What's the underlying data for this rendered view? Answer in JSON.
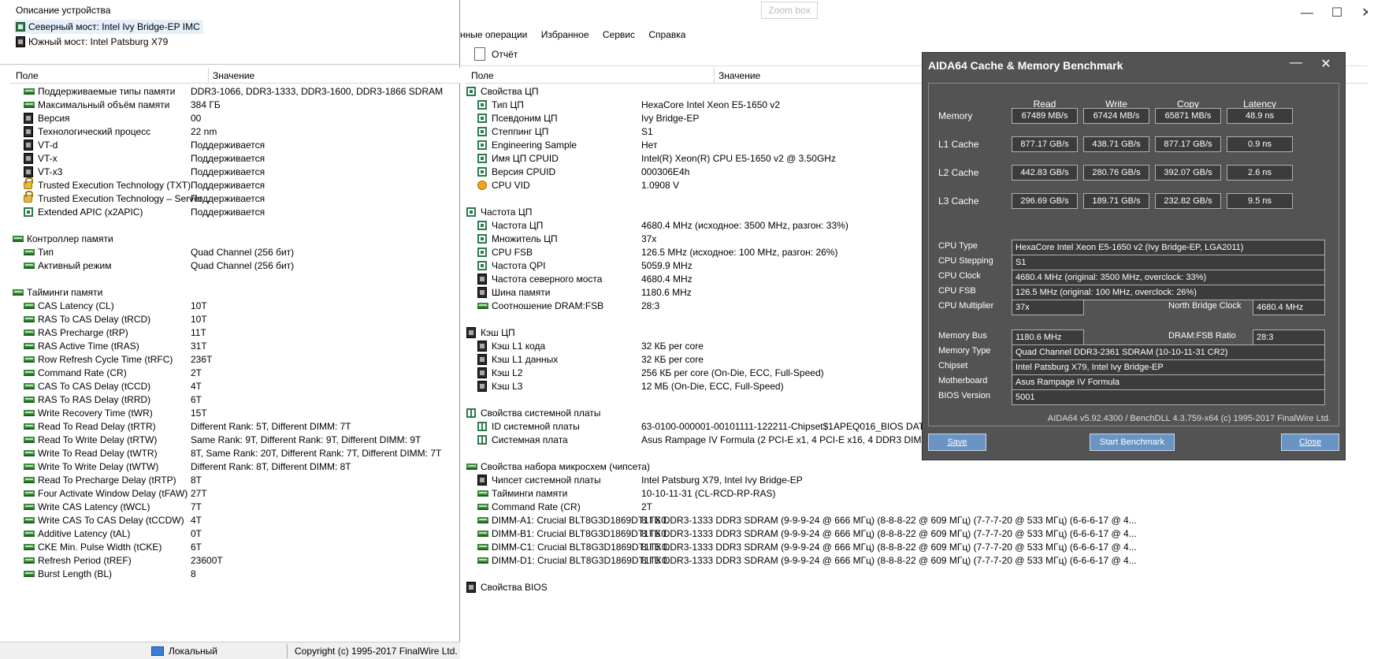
{
  "left": {
    "device_desc_title": "Описание устройства",
    "devices": [
      "Северный мост: Intel Ivy Bridge-EP IMC",
      "Южный мост: Intel Patsburg X79"
    ],
    "col_field": "Поле",
    "col_value": "Значение",
    "rows": [
      {
        "f": "Поддерживаемые типы памяти",
        "v": "DDR3-1066, DDR3-1333, DDR3-1600, DDR3-1866 SDRAM",
        "icon": "mem"
      },
      {
        "f": "Максимальный объём памяти",
        "v": "384 ГБ",
        "icon": "mem"
      },
      {
        "f": "Версия",
        "v": "00",
        "icon": "chip-black"
      },
      {
        "f": "Технологический процесс",
        "v": "22 nm",
        "icon": "chip-black"
      },
      {
        "f": "VT-d",
        "v": "Поддерживается",
        "icon": "vt"
      },
      {
        "f": "VT-x",
        "v": "Поддерживается",
        "icon": "vt"
      },
      {
        "f": "VT-x3",
        "v": "Поддерживается",
        "icon": "vt"
      },
      {
        "f": "Trusted Execution Technology (TXT)",
        "v": "Поддерживается",
        "icon": "lock"
      },
      {
        "f": "Trusted Execution Technology – Server...",
        "v": "Поддерживается",
        "icon": "lock"
      },
      {
        "f": "Extended APIC (x2APIC)",
        "v": "Поддерживается",
        "icon": "cpu"
      },
      {
        "f": "",
        "v": "",
        "icon": ""
      },
      {
        "f": "Контроллер памяти",
        "v": "",
        "icon": "mem",
        "group": true
      },
      {
        "f": "Тип",
        "v": "Quad Channel  (256 бит)",
        "icon": "mem"
      },
      {
        "f": "Активный режим",
        "v": "Quad Channel  (256 бит)",
        "icon": "mem"
      },
      {
        "f": "",
        "v": "",
        "icon": ""
      },
      {
        "f": "Тайминги памяти",
        "v": "",
        "icon": "mem",
        "group": true
      },
      {
        "f": "CAS Latency (CL)",
        "v": "10T",
        "icon": "mem"
      },
      {
        "f": "RAS To CAS Delay (tRCD)",
        "v": "10T",
        "icon": "mem"
      },
      {
        "f": "RAS Precharge (tRP)",
        "v": "11T",
        "icon": "mem"
      },
      {
        "f": "RAS Active Time (tRAS)",
        "v": "31T",
        "icon": "mem"
      },
      {
        "f": "Row Refresh Cycle Time (tRFC)",
        "v": "236T",
        "icon": "mem"
      },
      {
        "f": "Command Rate (CR)",
        "v": "2T",
        "icon": "mem"
      },
      {
        "f": "CAS To CAS Delay (tCCD)",
        "v": "4T",
        "icon": "mem"
      },
      {
        "f": "RAS To RAS Delay (tRRD)",
        "v": "6T",
        "icon": "mem"
      },
      {
        "f": "Write Recovery Time (tWR)",
        "v": "15T",
        "icon": "mem"
      },
      {
        "f": "Read To Read Delay (tRTR)",
        "v": "Different Rank: 5T, Different DIMM: 7T",
        "icon": "mem"
      },
      {
        "f": "Read To Write Delay (tRTW)",
        "v": "Same Rank: 9T, Different Rank: 9T, Different DIMM: 9T",
        "icon": "mem"
      },
      {
        "f": "Write To Read Delay (tWTR)",
        "v": "8T, Same Rank: 20T, Different Rank: 7T, Different DIMM: 7T",
        "icon": "mem"
      },
      {
        "f": "Write To Write Delay (tWTW)",
        "v": "Different Rank: 8T, Different DIMM: 8T",
        "icon": "mem"
      },
      {
        "f": "Read To Precharge Delay (tRTP)",
        "v": "8T",
        "icon": "mem"
      },
      {
        "f": "Four Activate Window Delay (tFAW)",
        "v": "27T",
        "icon": "mem"
      },
      {
        "f": "Write CAS Latency (tWCL)",
        "v": "7T",
        "icon": "mem"
      },
      {
        "f": "Write CAS To CAS Delay (tCCDW)",
        "v": "4T",
        "icon": "mem"
      },
      {
        "f": "Additive Latency (tAL)",
        "v": "0T",
        "icon": "mem"
      },
      {
        "f": "CKE Min. Pulse Width (tCKE)",
        "v": "6T",
        "icon": "mem"
      },
      {
        "f": "Refresh Period (tREF)",
        "v": "23600T",
        "icon": "mem"
      },
      {
        "f": "Burst Length (BL)",
        "v": "8",
        "icon": "mem"
      }
    ],
    "status_local": "Локальный",
    "status_copyright": "Copyright (c) 1995-2017 FinalWire Ltd."
  },
  "right": {
    "menu": [
      "нные операции",
      "Избранное",
      "Сервис",
      "Справка"
    ],
    "zoom_box": "Zoom box",
    "report_label": "Отчёт",
    "col_field": "Поле",
    "col_value": "Значение",
    "rows": [
      {
        "f": "Свойства ЦП",
        "v": "",
        "icon": "cpu",
        "group": true
      },
      {
        "f": "Тип ЦП",
        "v": "HexaCore Intel Xeon E5-1650 v2",
        "icon": "cpu"
      },
      {
        "f": "Псевдоним ЦП",
        "v": "Ivy Bridge-EP",
        "icon": "cpu"
      },
      {
        "f": "Степпинг ЦП",
        "v": "S1",
        "icon": "cpu"
      },
      {
        "f": "Engineering Sample",
        "v": "Нет",
        "icon": "cpu"
      },
      {
        "f": "Имя ЦП CPUID",
        "v": "Intel(R) Xeon(R) CPU E5-1650 v2 @ 3.50GHz",
        "icon": "cpu"
      },
      {
        "f": "Версия CPUID",
        "v": "000306E4h",
        "icon": "cpu"
      },
      {
        "f": "CPU VID",
        "v": "1.0908 V",
        "icon": "vid"
      },
      {
        "f": "",
        "v": "",
        "icon": ""
      },
      {
        "f": "Частота ЦП",
        "v": "",
        "icon": "cpu",
        "group": true
      },
      {
        "f": "Частота ЦП",
        "v": "4680.4 MHz  (исходное: 3500 MHz, разгон: 33%)",
        "icon": "cpu"
      },
      {
        "f": "Множитель ЦП",
        "v": "37x",
        "icon": "cpu"
      },
      {
        "f": "CPU FSB",
        "v": "126.5 MHz  (исходное: 100 MHz, разгон: 26%)",
        "icon": "cpu"
      },
      {
        "f": "Частота QPI",
        "v": "5059.9 MHz",
        "icon": "cpu"
      },
      {
        "f": "Частота северного моста",
        "v": "4680.4 MHz",
        "icon": "chip-black"
      },
      {
        "f": "Шина памяти",
        "v": "1180.6 MHz",
        "icon": "chip-black"
      },
      {
        "f": "Соотношение DRAM:FSB",
        "v": "28:3",
        "icon": "mem"
      },
      {
        "f": "",
        "v": "",
        "icon": ""
      },
      {
        "f": "Кэш ЦП",
        "v": "",
        "icon": "chip-black",
        "group": true
      },
      {
        "f": "Кэш L1 кода",
        "v": "32 КБ per core",
        "icon": "chip-black"
      },
      {
        "f": "Кэш L1 данных",
        "v": "32 КБ per core",
        "icon": "chip-black"
      },
      {
        "f": "Кэш L2",
        "v": "256 КБ per core  (On-Die, ECC, Full-Speed)",
        "icon": "chip-black"
      },
      {
        "f": "Кэш L3",
        "v": "12 МБ  (On-Die, ECC, Full-Speed)",
        "icon": "chip-black"
      },
      {
        "f": "",
        "v": "",
        "icon": ""
      },
      {
        "f": "Свойства системной платы",
        "v": "",
        "icon": "board",
        "group": true
      },
      {
        "f": "ID системной платы",
        "v": "63-0100-000001-00101111-122211-Chipset$1APEQ016_BIOS DATE: 12/05/14 10:21:41 VER: 50.01",
        "icon": "board"
      },
      {
        "f": "Системная плата",
        "v": "Asus Rampage IV Formula  (2 PCI-E x1, 4 PCI-E x16, 4 DDR3 DIMM, Audio, Gigabit LAN)",
        "icon": "board"
      },
      {
        "f": "",
        "v": "",
        "icon": ""
      },
      {
        "f": "Свойства набора микросхем (чипсета)",
        "v": "",
        "icon": "mem",
        "group": true
      },
      {
        "f": "Чипсет системной платы",
        "v": "Intel Patsburg X79, Intel Ivy Bridge-EP",
        "icon": "chip-black"
      },
      {
        "f": "Тайминги памяти",
        "v": "10-10-11-31  (CL-RCD-RP-RAS)",
        "icon": "mem"
      },
      {
        "f": "Command Rate (CR)",
        "v": "2T",
        "icon": "mem"
      },
      {
        "f": "DIMM-A1: Crucial BLT8G3D1869DT1TX0.",
        "v": "8 ГБ DDR3-1333 DDR3 SDRAM  (9-9-9-24 @ 666 МГц)  (8-8-8-22 @ 609 МГц)  (7-7-7-20 @ 533 МГц)  (6-6-6-17 @ 4...",
        "icon": "mem"
      },
      {
        "f": "DIMM-B1: Crucial BLT8G3D1869DT1TX0.",
        "v": "8 ГБ DDR3-1333 DDR3 SDRAM  (9-9-9-24 @ 666 МГц)  (8-8-8-22 @ 609 МГц)  (7-7-7-20 @ 533 МГц)  (6-6-6-17 @ 4...",
        "icon": "mem"
      },
      {
        "f": "DIMM-C1: Crucial BLT8G3D1869DT1TX0.",
        "v": "8 ГБ DDR3-1333 DDR3 SDRAM  (9-9-9-24 @ 666 МГц)  (8-8-8-22 @ 609 МГц)  (7-7-7-20 @ 533 МГц)  (6-6-6-17 @ 4...",
        "icon": "mem"
      },
      {
        "f": "DIMM-D1: Crucial BLT8G3D1869DT1TX0.",
        "v": "8 ГБ DDR3-1333 DDR3 SDRAM  (9-9-9-24 @ 666 МГц)  (8-8-8-22 @ 609 МГц)  (7-7-7-20 @ 533 МГц)  (6-6-6-17 @ 4...",
        "icon": "mem"
      },
      {
        "f": "",
        "v": "",
        "icon": ""
      },
      {
        "f": "Свойства BIOS",
        "v": "",
        "icon": "chip-black",
        "group": true
      }
    ]
  },
  "aida": {
    "title": "AIDA64 Cache & Memory Benchmark",
    "headers": [
      "Read",
      "Write",
      "Copy",
      "Latency"
    ],
    "bench": [
      {
        "label": "Memory",
        "vals": [
          "67489 MB/s",
          "67424 MB/s",
          "65871 MB/s",
          "48.9 ns"
        ]
      },
      {
        "label": "L1 Cache",
        "vals": [
          "877.17 GB/s",
          "438.71 GB/s",
          "877.17 GB/s",
          "0.9 ns"
        ]
      },
      {
        "label": "L2 Cache",
        "vals": [
          "442.83 GB/s",
          "280.76 GB/s",
          "392.07 GB/s",
          "2.6 ns"
        ]
      },
      {
        "label": "L3 Cache",
        "vals": [
          "296.69 GB/s",
          "189.71 GB/s",
          "232.82 GB/s",
          "9.5 ns"
        ]
      }
    ],
    "info": {
      "cpu_type_label": "CPU Type",
      "cpu_type": "HexaCore Intel Xeon E5-1650 v2  (Ivy Bridge-EP, LGA2011)",
      "cpu_stepping_label": "CPU Stepping",
      "cpu_stepping": "S1",
      "cpu_clock_label": "CPU Clock",
      "cpu_clock": "4680.4 MHz  (original: 3500 MHz, overclock: 33%)",
      "cpu_fsb_label": "CPU FSB",
      "cpu_fsb": "126.5 MHz  (original: 100 MHz, overclock: 26%)",
      "cpu_mult_label": "CPU Multiplier",
      "cpu_mult": "37x",
      "nb_clock_label": "North Bridge Clock",
      "nb_clock": "4680.4 MHz",
      "mem_bus_label": "Memory Bus",
      "mem_bus": "1180.6 MHz",
      "dram_fsb_label": "DRAM:FSB Ratio",
      "dram_fsb": "28:3",
      "mem_type_label": "Memory Type",
      "mem_type": "Quad Channel DDR3-2361 SDRAM  (10-10-11-31 CR2)",
      "chipset_label": "Chipset",
      "chipset": "Intel Patsburg X79, Intel Ivy Bridge-EP",
      "mobo_label": "Motherboard",
      "mobo": "Asus Rampage IV Formula",
      "bios_label": "BIOS Version",
      "bios": "5001"
    },
    "credits": "AIDA64 v5.92.4300 / BenchDLL 4.3.759-x64  (c) 1995-2017 FinalWire Ltd.",
    "btn_save": "Save",
    "btn_start": "Start Benchmark",
    "btn_close": "Close"
  }
}
